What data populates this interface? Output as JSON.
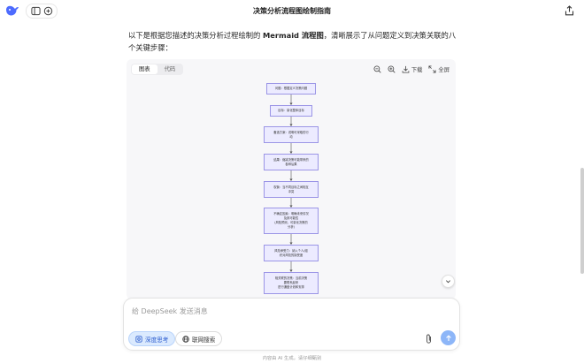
{
  "header": {
    "title": "决策分析流程图绘制指南"
  },
  "message": {
    "intro_prefix": "以下是根据您描述的决策分析过程绘制的 ",
    "intro_bold": "Mermaid 流程图",
    "intro_suffix": "，清晰展示了从问题定义到决策关联的八个关键步骤："
  },
  "diagram": {
    "tabs": [
      {
        "label": "图表",
        "active": true
      },
      {
        "label": "代码",
        "active": false
      }
    ],
    "download_label": "下载",
    "fullscreen_label": "全屏",
    "nodes": [
      {
        "id": "n1",
        "text": "问题：根据定义决策问题"
      },
      {
        "id": "n2",
        "text": "目标：量化整体目标"
      },
      {
        "id": "n3",
        "text": "备选方案：说明可采取的行\n动"
      },
      {
        "id": "n4",
        "text": "结果：缩减决策可能带来的\n各种后果"
      },
      {
        "id": "n5",
        "text": "权衡：当不同目标之间相互\n冲突"
      },
      {
        "id": "n6",
        "text": "不确定因素：明确未来情况\n及其可能性\n(风险预测、可量化决策的\n分析)"
      },
      {
        "id": "n7",
        "text": "风险承受力：纳入个人/组\n织对风险的接受度"
      },
      {
        "id": "n8",
        "text": "相关联的决策：当前决策\n要联系起来\n进行通盘计划和安排"
      }
    ],
    "node_fill": "#ecebff",
    "node_stroke": "#9b95e6"
  },
  "composer": {
    "placeholder": "给 DeepSeek 发送消息",
    "deep_think_label": "深度思考",
    "web_search_label": "联网搜索"
  },
  "footer": {
    "disclaimer": "内容由 AI 生成，请仔细甄别"
  },
  "colors": {
    "accent": "#4d6bfe",
    "deep_think_bg": "#dbeafe",
    "send_button": "#8db6f8"
  },
  "icons": [
    "deepseek-logo-icon",
    "sidebar-toggle-icon",
    "new-chat-icon",
    "share-icon",
    "zoom-out-icon",
    "zoom-in-icon",
    "download-icon",
    "fullscreen-icon",
    "chevron-down-icon",
    "deep-think-icon",
    "globe-icon",
    "paperclip-icon",
    "arrow-up-icon"
  ]
}
